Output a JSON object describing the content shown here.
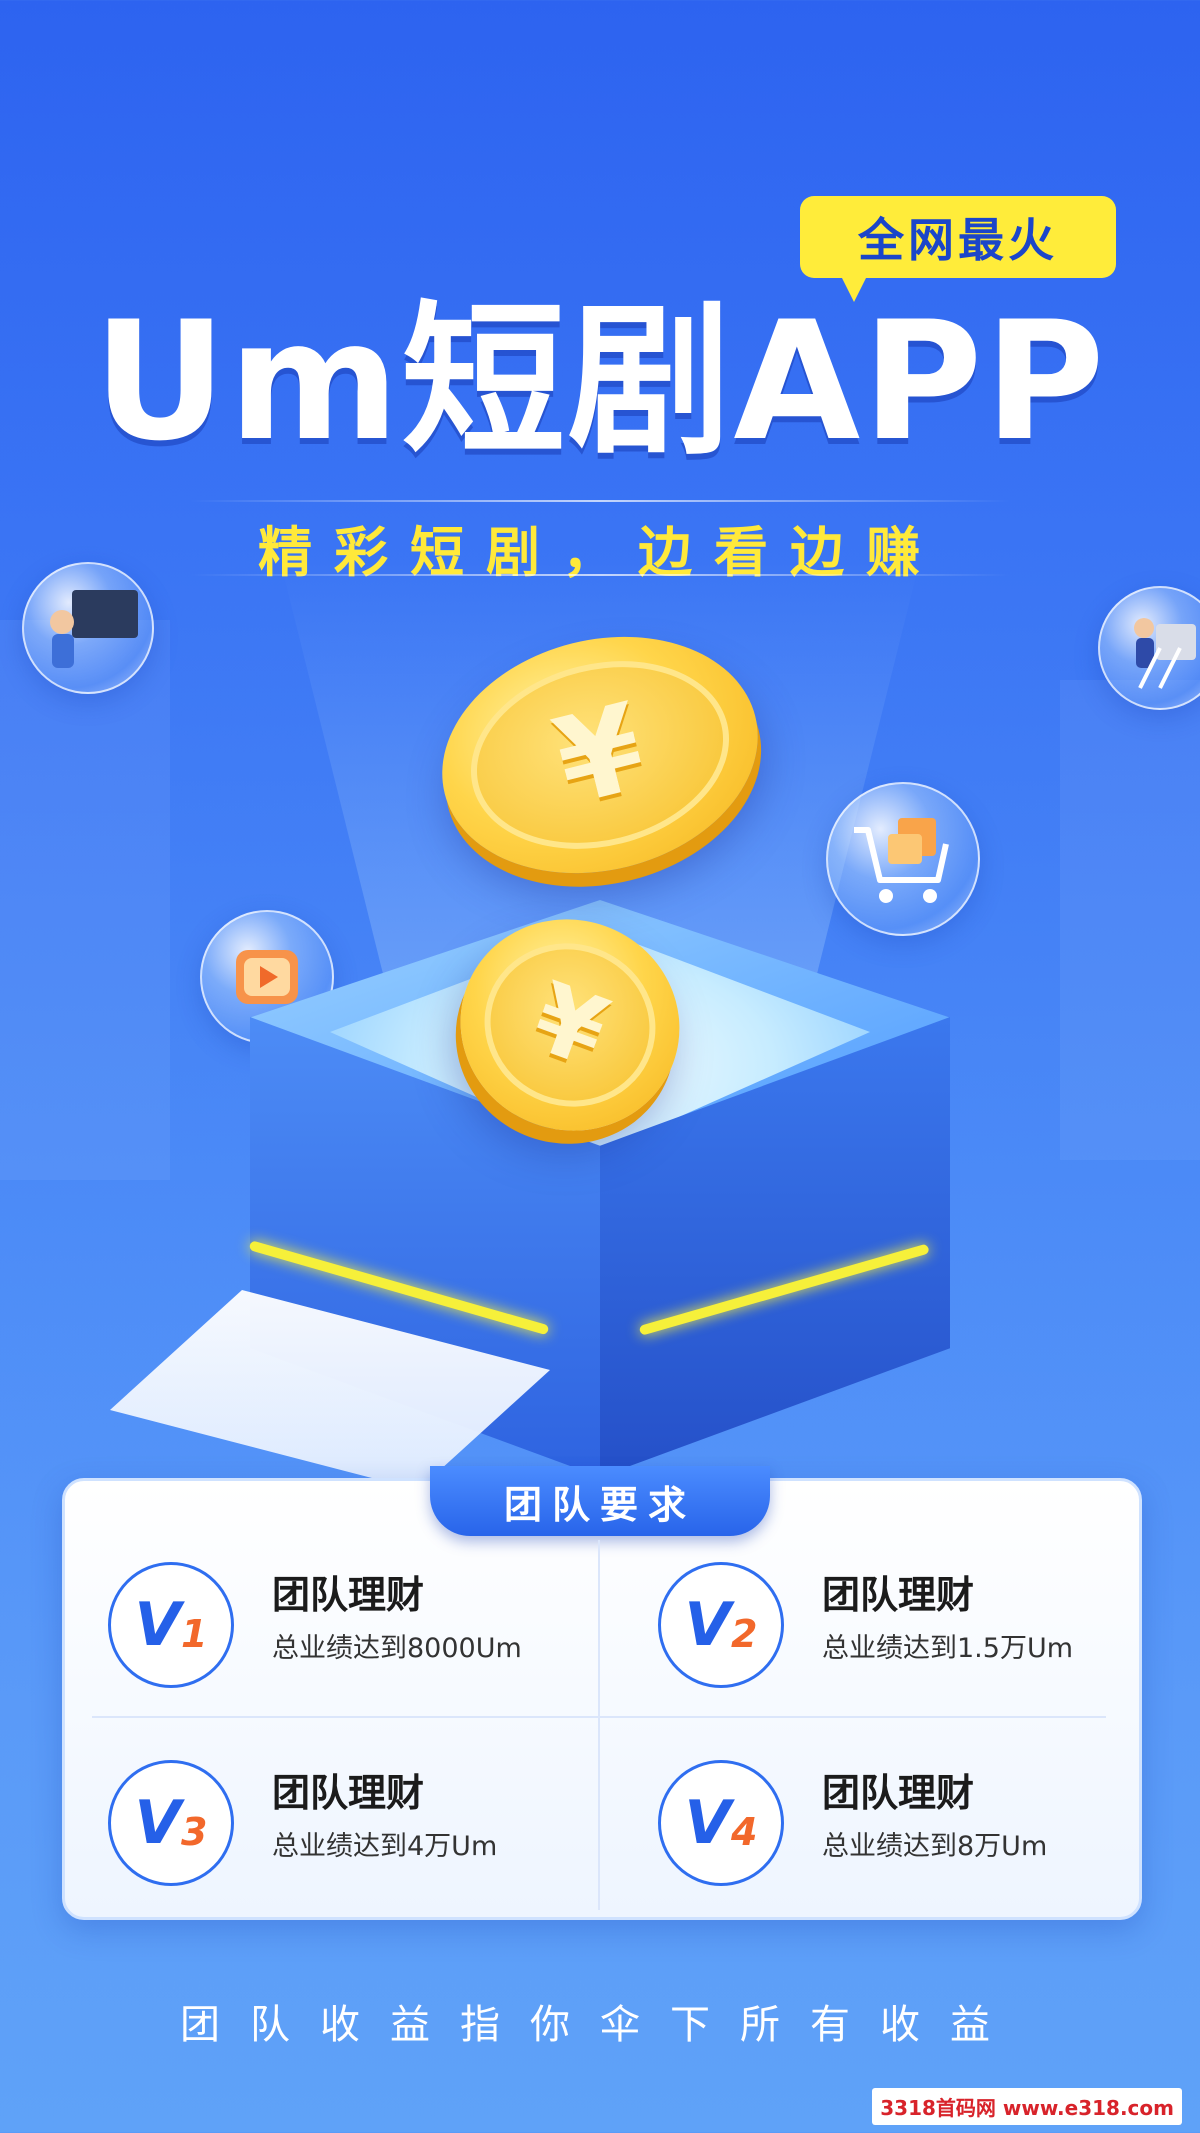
{
  "badge": {
    "label": "全网最火"
  },
  "headline": {
    "title": "Um短剧APP",
    "subtitle": "精彩短剧，边看边赚"
  },
  "coins": {
    "symbol": "¥"
  },
  "team_card": {
    "tab_label": "团队要求",
    "tiers": [
      {
        "level_letter": "V",
        "level_number": "1",
        "title": "团队理财",
        "desc": "总业绩达到8000Um"
      },
      {
        "level_letter": "V",
        "level_number": "2",
        "title": "团队理财",
        "desc": "总业绩达到1.5万Um"
      },
      {
        "level_letter": "V",
        "level_number": "3",
        "title": "团队理财",
        "desc": "总业绩达到4万Um"
      },
      {
        "level_letter": "V",
        "level_number": "4",
        "title": "团队理财",
        "desc": "总业绩达到8万Um"
      }
    ]
  },
  "footer": {
    "text": "团队收益指你伞下所有收益"
  },
  "watermark": {
    "text": "3318首码网 www.e318.com"
  },
  "colors": {
    "accent_yellow": "#ffec3a",
    "brand_blue": "#2d63f0",
    "level_orange": "#f2682b"
  }
}
